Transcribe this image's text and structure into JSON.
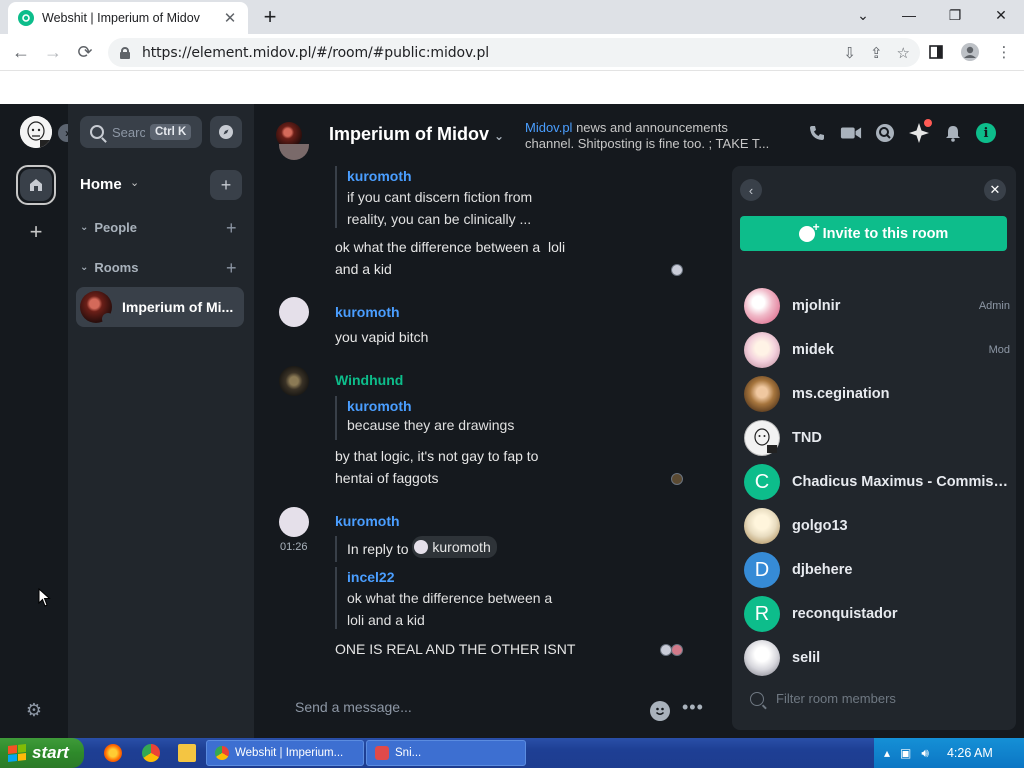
{
  "browser": {
    "tab_title": "Webshit | Imperium of Midov",
    "url": "https://element.midov.pl/#/room/#public:midov.pl",
    "window_buttons": [
      "minimize",
      "restore",
      "close"
    ]
  },
  "sidebar": {
    "search_placeholder": "Search",
    "search_shortcut": "Ctrl K",
    "home_label": "Home",
    "sections": [
      {
        "label": "People"
      },
      {
        "label": "Rooms"
      }
    ],
    "rooms": [
      {
        "name": "Imperium of Mi..."
      }
    ]
  },
  "room_header": {
    "title": "Imperium of Midov",
    "topic_link": "Midov.pl",
    "topic_line1_rest": " news and announcements",
    "topic_line2": "channel. Shitposting is fine too. ; TAKE T..."
  },
  "messages": [
    {
      "quote_sender": "kuromoth",
      "quote_lines": [
        "if you cant discern fiction from",
        "reality, you can be clinically ..."
      ],
      "body_lines": [
        "ok what the difference between a  loli",
        "and a kid"
      ]
    },
    {
      "sender": "kuromoth",
      "sender_color": "#4a9eff",
      "body_lines": [
        "you vapid bitch"
      ]
    },
    {
      "sender": "Windhund",
      "sender_color": "#0dbd8b",
      "quote_sender": "kuromoth",
      "quote_lines": [
        "because they are drawings"
      ],
      "body_lines": [
        "by that logic, it's not gay to fap to",
        "hentai of faggots"
      ]
    },
    {
      "sender": "kuromoth",
      "sender_color": "#4a9eff",
      "timestamp": "01:26",
      "reply_prefix": "In reply to",
      "reply_user": "kuromoth",
      "quote_sender": "incel22",
      "quote_lines": [
        "ok what the difference between a",
        "loli and a kid"
      ],
      "body_lines": [
        "ONE IS REAL AND THE OTHER ISNT"
      ]
    }
  ],
  "composer": {
    "placeholder": "Send a message..."
  },
  "right_panel": {
    "invite_label": "Invite to this room",
    "filter_placeholder": "Filter room members",
    "members": [
      {
        "name": "mjolnir",
        "role": "Admin",
        "avatar_color": "#f2dce3"
      },
      {
        "name": "midek",
        "role": "Mod",
        "avatar_color": "#f0e4e8"
      },
      {
        "name": "ms.cegination",
        "role": "",
        "avatar_color": "#a7763e"
      },
      {
        "name": "TND",
        "role": "",
        "avatar_color": "#f2f2f2"
      },
      {
        "name": "Chadicus Maximus - Commiss...",
        "role": "",
        "avatar_color": "#0dbd8b",
        "initial": "C"
      },
      {
        "name": "golgo13",
        "role": "",
        "avatar_color": "#e8dcc0"
      },
      {
        "name": "djbehere",
        "role": "",
        "avatar_color": "#368bd6",
        "initial": "D"
      },
      {
        "name": "reconquistador",
        "role": "",
        "avatar_color": "#0dbd8b",
        "initial": "R"
      },
      {
        "name": "selil",
        "role": "",
        "avatar_color": "#d6d6dc"
      }
    ]
  },
  "taskbar": {
    "start_label": "start",
    "task1": "Webshit | Imperium...",
    "task2": "Sni...",
    "clock": "4:26 AM"
  },
  "colors": {
    "accent": "#0dbd8b",
    "link": "#4a9eff",
    "background": "#15191e",
    "panel": "#21262c"
  }
}
